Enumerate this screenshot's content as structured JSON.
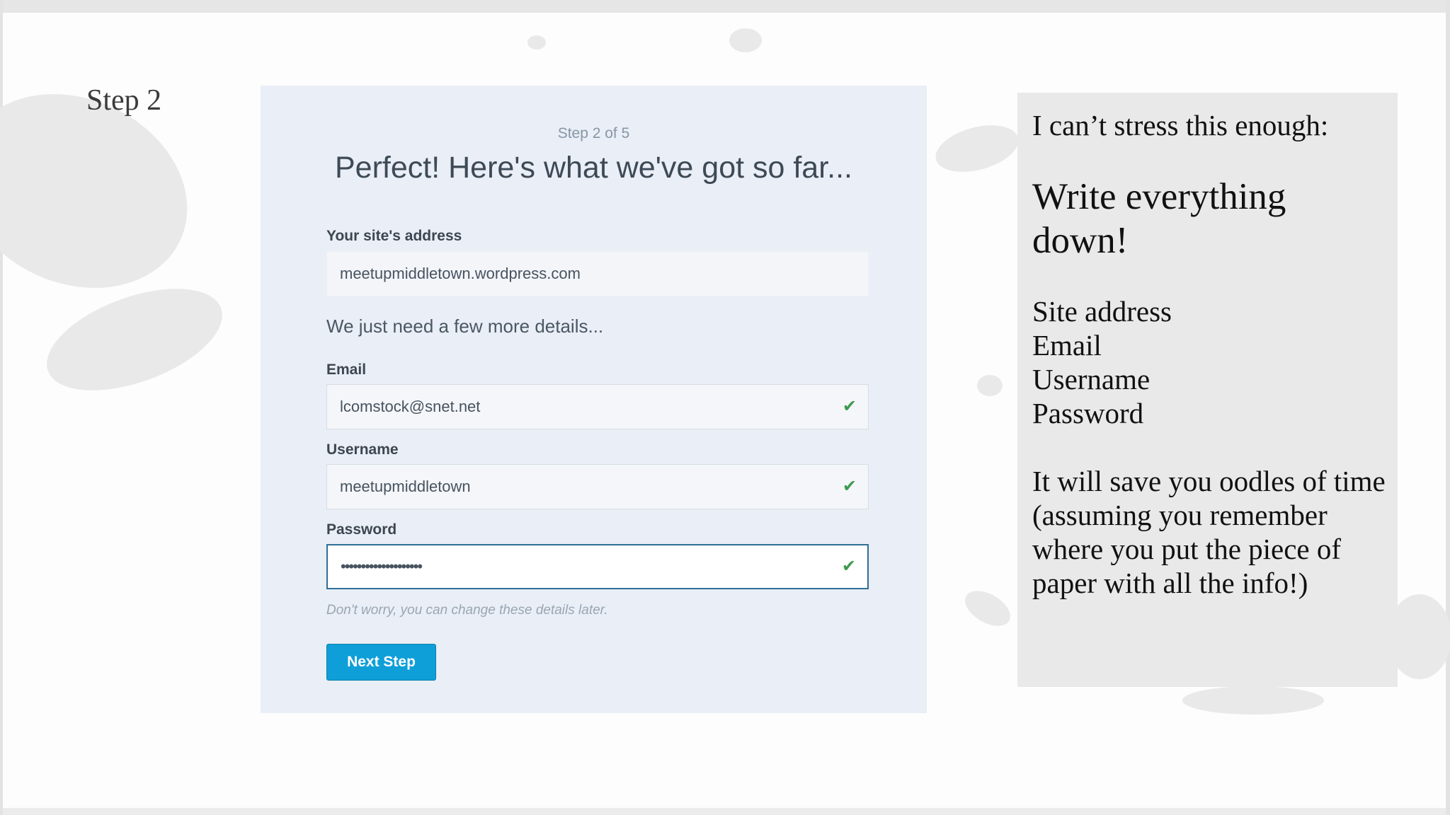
{
  "slide": {
    "step_title": "Step 2"
  },
  "form": {
    "step_count": "Step 2 of 5",
    "headline": "Perfect! Here's what we've got so far...",
    "site_label": "Your site's address",
    "site_value": "meetupmiddletown.wordpress.com",
    "subtext": "We just need a few more details...",
    "email_label": "Email",
    "email_value": "lcomstock@snet.net",
    "username_label": "Username",
    "username_value": "meetupmiddletown",
    "password_label": "Password",
    "password_value": "••••••••••••••••••••",
    "check_glyph": "✔",
    "hint": "Don't worry, you can change these details later.",
    "next_button": "Next Step",
    "accent_color": "#0f9fd8",
    "valid_color": "#3f9a4f"
  },
  "notes": {
    "intro": "I can’t stress this enough:",
    "emphasis": "Write everything down!",
    "items": [
      "Site address",
      "Email",
      "Username",
      "Password"
    ],
    "closing": "It will save you oodles of time (assuming you remember where you put the piece of paper with all the info!)"
  }
}
